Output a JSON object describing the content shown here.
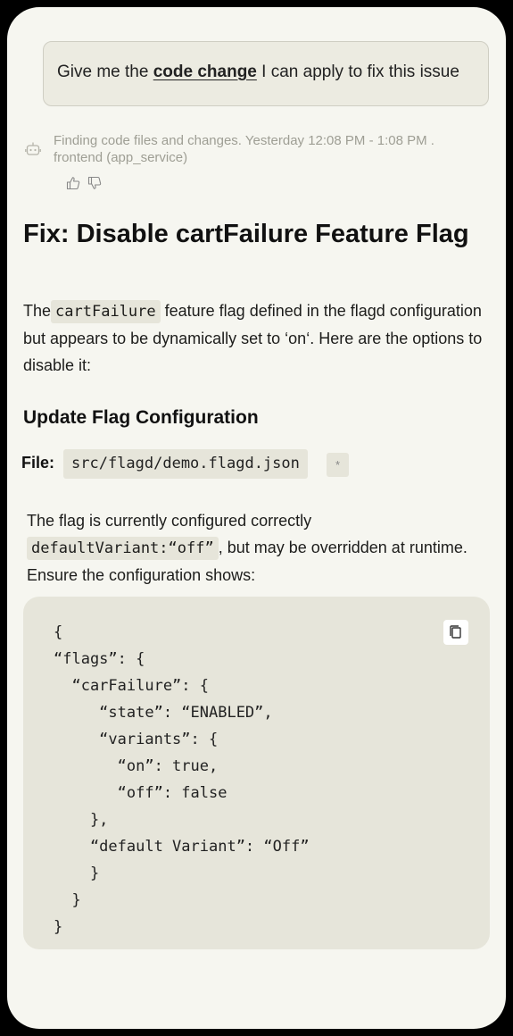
{
  "user_message": {
    "prefix": "Give me the ",
    "emphasis": "code change",
    "suffix": " I can apply to fix this issue"
  },
  "status": {
    "line1": "Finding code files and changes. Yesterday 12:08 PM - 1:08 PM .",
    "line2": "frontend (app_service)"
  },
  "icons": {
    "status": "robot-icon",
    "thumbs_up": "thumbs-up-icon",
    "thumbs_down": "thumbs-down-icon",
    "copy": "copy-icon"
  },
  "answer": {
    "title": "Fix: Disable cartFailure Feature Flag",
    "intro": {
      "before": "The",
      "code": "cartFailure",
      "after": " feature flag defined in the flagd configuration but appears to be dynamically set to ‘on‘. Here are the options to disable it:"
    },
    "section_heading": "Update Flag Configuration",
    "file_label": "File:",
    "file_path": "src/flagd/demo.flagd.json",
    "file_button": "*",
    "note": {
      "before": "The flag  is currently configured correctly",
      "code": "defaultVariant:“off”",
      "after": ",  but may be overridden at runtime. Ensure the configuration shows:"
    },
    "code_block": "{\n“flags”: {\n  “carFailure”: {\n     “state”: “ENABLED”,\n     “variants”: {\n       “on”: true,\n       “off”: false\n    },\n    “default Variant”: “Off”\n    }\n  }\n}"
  }
}
